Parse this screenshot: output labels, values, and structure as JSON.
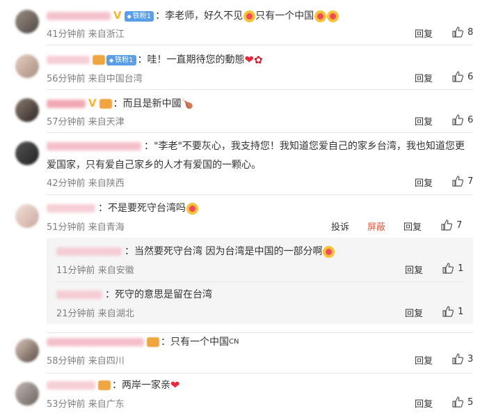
{
  "comments": [
    {
      "text": "李老师，好久不见",
      "text2": "只有一个中国",
      "fan_label": "铁粉1",
      "time": "41分钟前",
      "location": "来自浙江",
      "reply_label": "回复",
      "likes": "8"
    },
    {
      "text": "哇！一直期待您的動態",
      "fan_label": "铁粉1",
      "time": "56分钟前",
      "location": "来自中国台湾",
      "reply_label": "回复",
      "likes": "6"
    },
    {
      "text": "而且是新中國",
      "time": "57分钟前",
      "location": "来自天津",
      "reply_label": "回复",
      "likes": "6"
    },
    {
      "text": "\"李老\"不要灰心，我支持您！我知道您爱自己的家乡台湾，我也知道您更",
      "text_cont": "爱国家，只有爱自己家乡的人才有爱国的一颗心。",
      "time": "42分钟前",
      "location": "来自陕西",
      "reply_label": "回复",
      "likes": "7"
    },
    {
      "text": "不是要死守台湾吗",
      "time": "51分钟前",
      "location": "来自青海",
      "report_label": "投诉",
      "block_label": "屏蔽",
      "reply_label": "回复",
      "likes": "7",
      "replies": [
        {
          "text": "当然要死守台湾 因为台湾是中国的一部分啊",
          "time": "11分钟前",
          "location": "来自安徽",
          "reply_label": "回复",
          "likes": "1"
        },
        {
          "text": "死守的意思是留在台湾",
          "time": "21分钟前",
          "location": "来自湖北",
          "reply_label": "回复",
          "likes": "1"
        }
      ]
    },
    {
      "text": "只有一个中国",
      "flag": "CN",
      "time": "58分钟前",
      "location": "来自四川",
      "reply_label": "回复",
      "likes": "3"
    },
    {
      "text": "两岸一家亲",
      "time": "53分钟前",
      "location": "来自广东",
      "reply_label": "回复",
      "likes": "5"
    }
  ],
  "colors": {
    "block": "#e8583a",
    "fan_badge": "#5a9ee8",
    "meta": "#808080",
    "heart": "#e8283a"
  }
}
